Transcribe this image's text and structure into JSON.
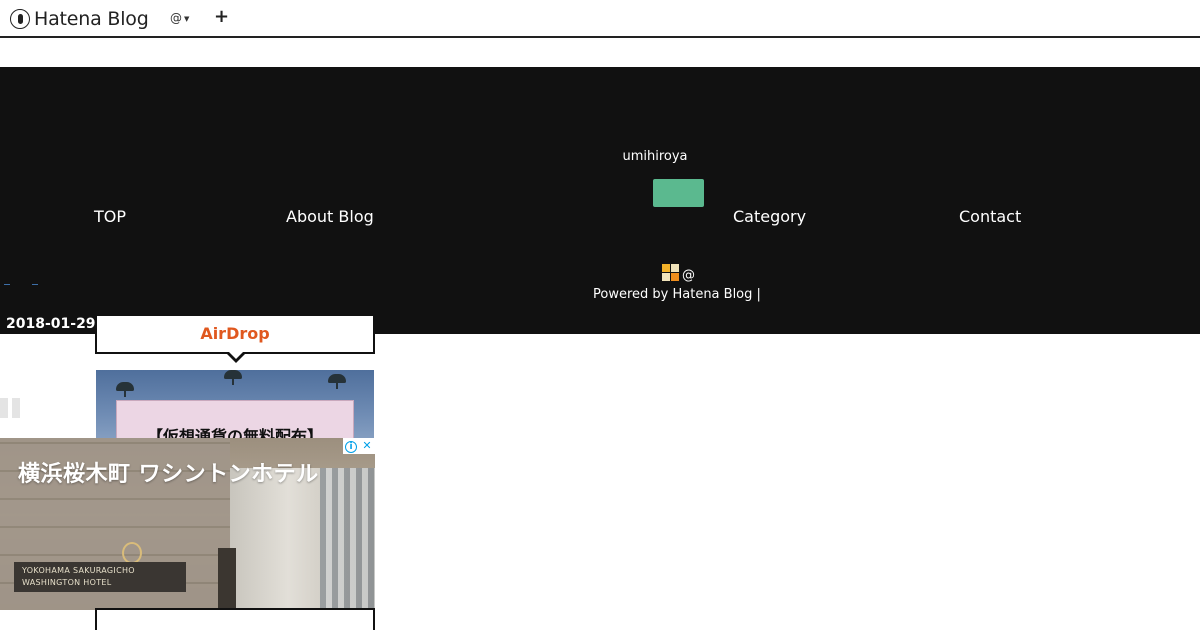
{
  "toolbar": {
    "brand": "Hatena Blog",
    "user_menu": "@",
    "add_label": "+"
  },
  "header": {
    "owner": "umihiroya",
    "nav": [
      "TOP",
      "About Blog",
      "Category",
      "Contact"
    ],
    "account": "@",
    "powered_by": "Powered by Hatena Blog |",
    "accent_color": "#5bb98f",
    "background": "#111111"
  },
  "article": {
    "date": "2018-01-29",
    "label": "AirDrop",
    "eyecatch_text": "【仮想通貨の無料配布】"
  },
  "ad": {
    "title": "横浜桜木町 ワシントンホテル",
    "plaque": "YOKOHAMA SAKURAGICHO WASHINGTON HOTEL",
    "info_icon": "i",
    "close_icon": "✕"
  }
}
